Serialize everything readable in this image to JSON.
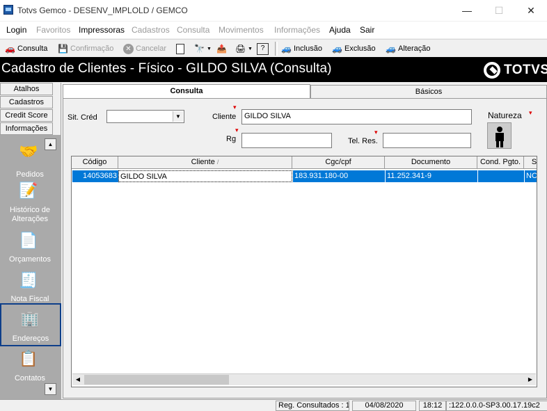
{
  "window": {
    "title": "Totvs Gemco - DESENV_IMPLOLD / GEMCO",
    "minimize": "—",
    "maximize": "☐",
    "close": "✕"
  },
  "menu": [
    {
      "label": "Login",
      "enabled": true
    },
    {
      "label": "Favoritos",
      "enabled": false
    },
    {
      "label": "Impressoras",
      "enabled": true
    },
    {
      "label": "Cadastros",
      "enabled": false
    },
    {
      "label": "Consulta",
      "enabled": false
    },
    {
      "label": "Movimentos",
      "enabled": false
    },
    {
      "label": "Informações",
      "enabled": false
    },
    {
      "label": "Ajuda",
      "enabled": true
    },
    {
      "label": "Sair",
      "enabled": true
    }
  ],
  "toolbar": {
    "consulta": "Consulta",
    "confirmacao": "Confirmação",
    "cancelar": "Cancelar",
    "inclusao": "Inclusão",
    "exclusao": "Exclusão",
    "alteracao": "Alteração"
  },
  "header": {
    "title": "Cadastro de Clientes - Físico  - GILDO SILVA (Consulta)",
    "logo_text": "TOTVS"
  },
  "left_panel": {
    "buttons": [
      "Atalhos",
      "Cadastros",
      "Credit Score",
      "Informações"
    ],
    "shortcuts": [
      {
        "label": "Pedidos",
        "icon": "handshake-icon"
      },
      {
        "label": "Histórico de Alterações",
        "icon": "history-icon"
      },
      {
        "label": "Orçamentos",
        "icon": "document-icon"
      },
      {
        "label": "Nota Fiscal",
        "icon": "invoice-icon"
      },
      {
        "label": "Endereços",
        "icon": "building-icon"
      },
      {
        "label": "Contatos",
        "icon": "contacts-icon"
      }
    ]
  },
  "tabs": [
    {
      "label": "Consulta",
      "active": true
    },
    {
      "label": "Básicos",
      "active": false
    }
  ],
  "form": {
    "sit_cred_label": "Sit. Créd",
    "sit_cred_value": "",
    "cliente_label": "Cliente",
    "cliente_value": "GILDO SILVA",
    "natureza_label": "Natureza",
    "rg_label": "Rg",
    "rg_value": "",
    "tel_res_label": "Tel. Res.",
    "tel_res_value": ""
  },
  "grid": {
    "columns": [
      "Código",
      "Cliente",
      "Cgc/cpf",
      "Documento",
      "Cond. Pgto.",
      "S"
    ],
    "rows": [
      [
        "14053683",
        "GILDO SILVA",
        "183.931.180-00",
        "11.252.341-9",
        "",
        "NC"
      ]
    ]
  },
  "status_bar": {
    "records": "Reg. Consultados : 1",
    "date": "04/08/2020",
    "time": "18:12",
    "version": ":122.0.0.0-SP3.00.17.19c2"
  },
  "colors": {
    "selection": "#0078d7",
    "banner": "#000000",
    "shortcut_panel": "#aaaaaa"
  }
}
